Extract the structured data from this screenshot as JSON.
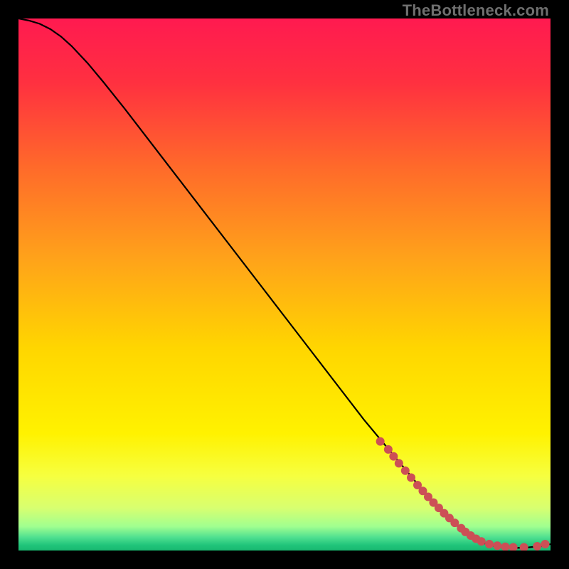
{
  "watermark": "TheBottleneck.com",
  "chart_data": {
    "type": "line",
    "title": "",
    "xlabel": "",
    "ylabel": "",
    "xlim": [
      0,
      100
    ],
    "ylim": [
      0,
      100
    ],
    "grid": false,
    "legend": false,
    "background_gradient": {
      "stops": [
        {
          "offset": 0.0,
          "color": "#ff1a50"
        },
        {
          "offset": 0.12,
          "color": "#ff3040"
        },
        {
          "offset": 0.28,
          "color": "#ff6a2a"
        },
        {
          "offset": 0.45,
          "color": "#ffa21a"
        },
        {
          "offset": 0.62,
          "color": "#ffd600"
        },
        {
          "offset": 0.78,
          "color": "#fff200"
        },
        {
          "offset": 0.86,
          "color": "#f6ff40"
        },
        {
          "offset": 0.92,
          "color": "#d8ff70"
        },
        {
          "offset": 0.955,
          "color": "#a0ff90"
        },
        {
          "offset": 0.975,
          "color": "#50e090"
        },
        {
          "offset": 0.99,
          "color": "#20c47a"
        },
        {
          "offset": 1.0,
          "color": "#18b870"
        }
      ]
    },
    "series": [
      {
        "name": "curve",
        "stroke": "#000000",
        "stroke_width": 2.2,
        "x": [
          0,
          2,
          4,
          6,
          8,
          10,
          13,
          16,
          20,
          25,
          30,
          35,
          40,
          45,
          50,
          55,
          60,
          65,
          70,
          75,
          80,
          84,
          86,
          88,
          90,
          92,
          94,
          96,
          98,
          100
        ],
        "y": [
          100,
          99.6,
          99.0,
          98.0,
          96.6,
          94.8,
          91.6,
          88.0,
          83.0,
          76.5,
          70.0,
          63.5,
          57.0,
          50.5,
          44.0,
          37.5,
          31.0,
          24.5,
          18.5,
          12.5,
          7.0,
          3.2,
          2.0,
          1.2,
          0.7,
          0.5,
          0.5,
          0.6,
          0.8,
          1.2
        ]
      }
    ],
    "markers": {
      "name": "dotted-tail",
      "color": "#cc4f56",
      "radius": 6,
      "x": [
        68,
        69.5,
        70.5,
        71.5,
        72.7,
        73.8,
        75.0,
        76.0,
        77.0,
        78.0,
        79.0,
        80.0,
        81.0,
        82.0,
        83.2,
        84.0,
        85.0,
        86.0,
        87.0,
        88.5,
        90.0,
        91.5,
        93.0,
        95.0,
        97.5,
        99.0
      ],
      "y": [
        20.5,
        19.0,
        17.7,
        16.4,
        15.0,
        13.7,
        12.3,
        11.2,
        10.1,
        9.0,
        8.0,
        7.0,
        6.1,
        5.2,
        4.2,
        3.5,
        2.8,
        2.2,
        1.7,
        1.2,
        0.9,
        0.7,
        0.6,
        0.6,
        0.8,
        1.2
      ]
    }
  }
}
